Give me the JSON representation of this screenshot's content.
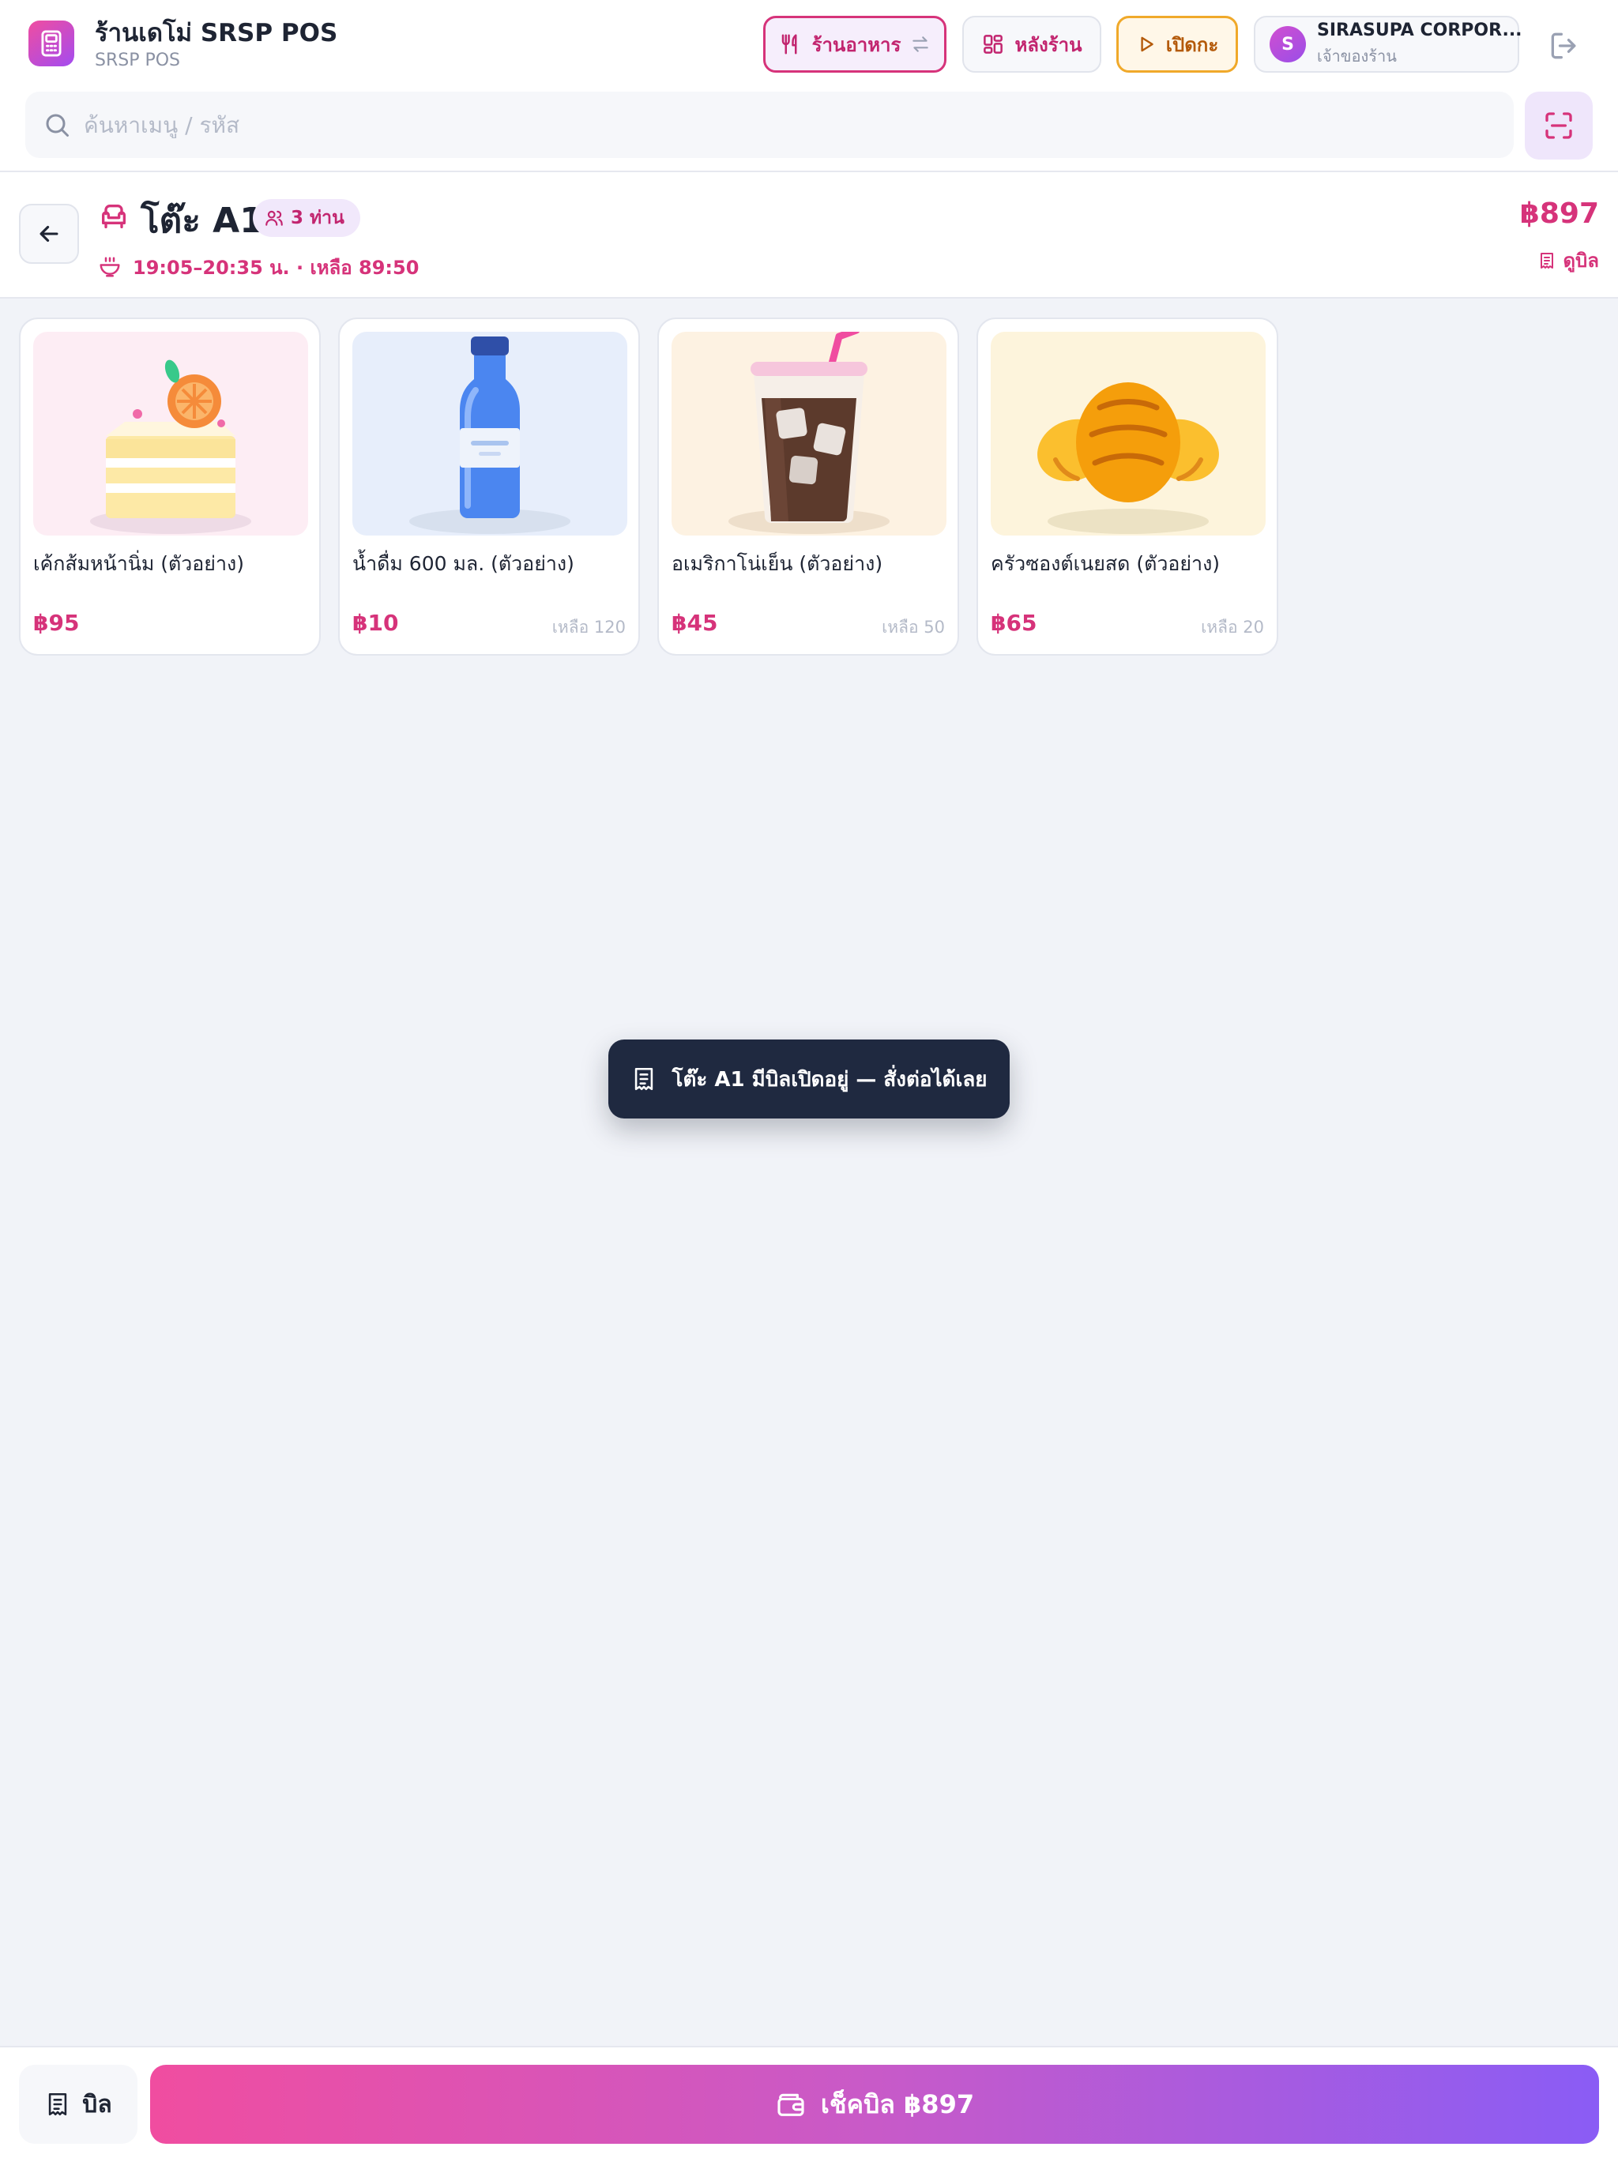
{
  "header": {
    "shop_name": "ร้านเดโม่ SRSP POS",
    "shop_sub": "SRSP POS",
    "mode_button": "ร้านอาหาร",
    "backoffice_button": "หลังร้าน",
    "shift_button": "เปิดกะ",
    "user": {
      "initial": "S",
      "name": "SIRASUPA CORPOR...",
      "role": "เจ้าของร้าน"
    }
  },
  "search": {
    "placeholder": "ค้นหาเมนู / รหัส",
    "value": ""
  },
  "table": {
    "name": "โต๊ะ A1",
    "guests": "3 ท่าน",
    "time": "19:05–20:35 น. · เหลือ 89:50",
    "total": "฿897",
    "view_bill": "ดูบิล"
  },
  "products": [
    {
      "name": "เค้กส้มหน้านิ่ม (ตัวอย่าง)",
      "price": "฿95",
      "stock": ""
    },
    {
      "name": "น้ำดื่ม 600 มล. (ตัวอย่าง)",
      "price": "฿10",
      "stock": "เหลือ 120"
    },
    {
      "name": "อเมริกาโน่เย็น (ตัวอย่าง)",
      "price": "฿45",
      "stock": "เหลือ 50"
    },
    {
      "name": "ครัวซองต์เนยสด (ตัวอย่าง)",
      "price": "฿65",
      "stock": "เหลือ 20"
    }
  ],
  "toast": {
    "message": "โต๊ะ A1 มีบิลเปิดอยู่ — สั่งต่อได้เลย"
  },
  "bottom": {
    "bill_label": "บิล",
    "checkout_label": "เช็คบิล ฿897"
  },
  "colors": {
    "accent": "#d6337a",
    "accent_end": "#8a5cf5",
    "shift": "#f0a92a",
    "toast_bg": "#1f2940"
  },
  "icons": {
    "logo": "pos-terminal-icon",
    "mode": "utensils-icon",
    "switch": "swap-arrows-icon",
    "backoffice": "dashboard-grid-icon",
    "shift": "play-icon",
    "logout": "logout-icon",
    "search": "search-icon",
    "scan": "barcode-scan-icon",
    "back": "arrow-left-icon",
    "table": "armchair-icon",
    "guests": "users-icon",
    "time": "hot-food-icon",
    "receipt": "receipt-icon",
    "wallet": "wallet-icon"
  }
}
